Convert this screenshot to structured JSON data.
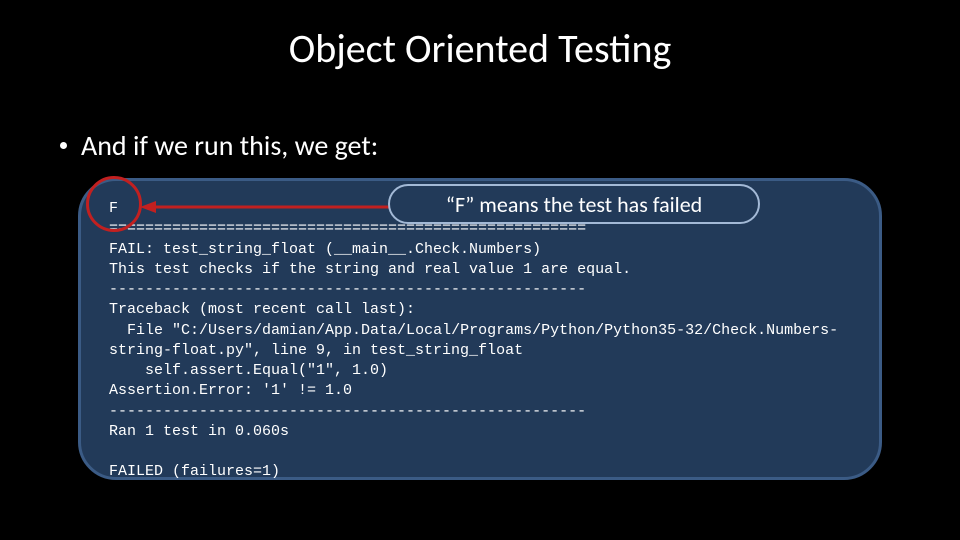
{
  "title": "Object Oriented Testing",
  "bullet": "And if we run this, we get:",
  "callout": "“F” means the test has failed",
  "code": {
    "l1": "F",
    "l2": "=====================================================",
    "l3": "FAIL: test_string_float (__main__.Check.Numbers)",
    "l4": "This test checks if the string and real value 1 are equal.",
    "l5": "-----------------------------------------------------",
    "l6": "Traceback (most recent call last):",
    "l7": "  File \"C:/Users/damian/App.Data/Local/Programs/Python/Python35-32/Check.Numbers-string-float.py\", line 9, in test_string_float",
    "l8": "    self.assert.Equal(\"1\", 1.0)",
    "l9": "Assertion.Error: '1' != 1.0",
    "l10": "-----------------------------------------------------",
    "l11": "Ran 1 test in 0.060s",
    "l12": "",
    "l13": "FAILED (failures=1)"
  },
  "colors": {
    "circle": "#c22020",
    "arrow": "#c22020",
    "panel": "#223a59",
    "panel_border": "#3b5b85",
    "callout_border": "#a3b9d6"
  }
}
